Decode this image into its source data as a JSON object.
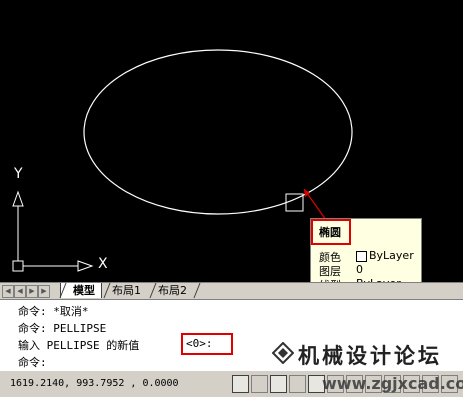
{
  "canvas": {
    "ucs_x_label": "X",
    "ucs_y_label": "Y"
  },
  "tabs": {
    "model": "模型",
    "layout1": "布局1",
    "layout2": "布局2"
  },
  "tooltip": {
    "title": "椭圆",
    "rows": [
      {
        "label": "颜色",
        "value": "ByLayer"
      },
      {
        "label": "图层",
        "value": "0"
      },
      {
        "label": "线型",
        "value": "ByLayer"
      }
    ]
  },
  "command": {
    "line1": "命令: *取消*",
    "line2": "命令: PELLIPSE",
    "line3_prefix": "输入 PELLIPSE 的新值",
    "line3_value": "<0>:",
    "line4": "命令:"
  },
  "statusbar": {
    "coords": "1619.2140, 993.7952 , 0.0000"
  },
  "watermark": {
    "name": "机械设计论坛",
    "url": "www.zgjxcad.com"
  },
  "colors": {
    "canvas_bg": "#000000",
    "entity": "#ffffff",
    "highlight_box": "#e00000"
  }
}
